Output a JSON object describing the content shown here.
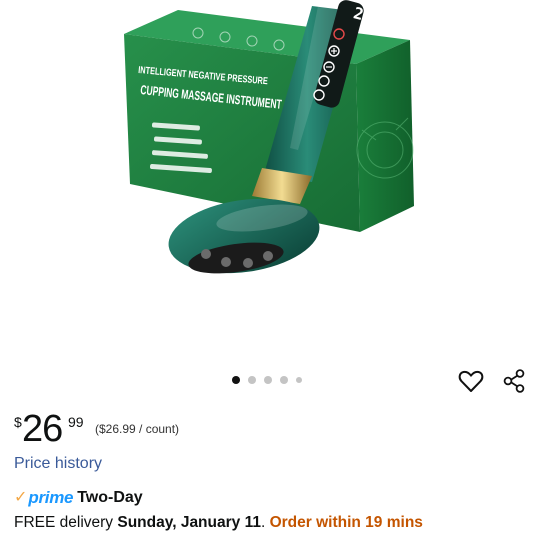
{
  "product": {
    "box_line1": "INTELLIGENT NEGATIVE PRESSURE",
    "box_line2": "CUPPING MASSAGE INSTRUMENT",
    "display_digit": "2"
  },
  "gallery": {
    "image_count": 5,
    "active_index": 0
  },
  "price": {
    "currency": "$",
    "whole": "26",
    "fraction": "99",
    "unit_price": "($26.99 / count)"
  },
  "price_history_link": "Price history",
  "shipping": {
    "prime_label": "prime",
    "speed": "Two-Day",
    "delivery_prefix": "FREE delivery ",
    "delivery_date": "Sunday, January 11",
    "separator": ". ",
    "order_within": "Order within 19 mins"
  },
  "colors": {
    "box_green": "#1f7a3e",
    "device_teal": "#1e6a5c",
    "prime_blue": "#1a98ff",
    "link_blue": "#3a5a99",
    "urgency_orange": "#c45500"
  }
}
